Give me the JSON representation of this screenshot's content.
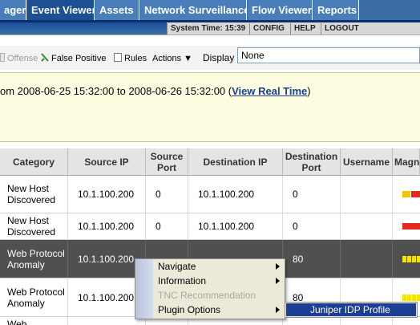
{
  "tabs": [
    {
      "label": "ager",
      "active": false
    },
    {
      "label": "Event Viewer",
      "active": true
    },
    {
      "label": "Assets",
      "active": false
    },
    {
      "label": "Network Surveillance",
      "active": false
    },
    {
      "label": "Flow Viewer",
      "active": false
    },
    {
      "label": "Reports",
      "active": false
    }
  ],
  "sysbar": {
    "time": "System Time: 15:39",
    "config": "CONFIG",
    "help": "HELP",
    "logout": "LOGOUT"
  },
  "toolbar": {
    "offense": "Offense",
    "false_positive": "False Positive",
    "rules": "Rules",
    "actions": "Actions ▼",
    "display_label": "Display",
    "display_value": "None"
  },
  "info": {
    "range_text": "om 2008-06-25 15:32:00 to 2008-06-26 15:32:00  (",
    "link": "View Real Time",
    "close_paren": ")"
  },
  "table": {
    "headers": {
      "category": "Category",
      "source_ip": "Source IP",
      "source_port": "Source Port",
      "destination_ip": "Destination IP",
      "destination_port": "Destination Port",
      "username": "Username",
      "magnitude": "Magn"
    },
    "rows": [
      {
        "category": "New Host Discovered",
        "source_ip": "10.1.100.200",
        "source_port": "0",
        "destination_ip": "10.1.100.200",
        "destination_port": "0",
        "username": "",
        "selected": false
      },
      {
        "category": "New Host Discovered",
        "source_ip": "10.1.100.200",
        "source_port": "0",
        "destination_ip": "10.1.100.200",
        "destination_port": "0",
        "username": "",
        "selected": false
      },
      {
        "category": "Web Protocol Anomaly",
        "source_ip": "10.1.100.200",
        "source_port": "",
        "destination_ip": "",
        "destination_port": "80",
        "username": "",
        "selected": true
      },
      {
        "category": "Web Protocol Anomaly",
        "source_ip": "10.1.100.200",
        "source_port": "",
        "destination_ip": "",
        "destination_port": "80",
        "username": "",
        "selected": false
      },
      {
        "category": "Web",
        "source_ip": "",
        "source_port": "",
        "destination_ip": "",
        "destination_port": "",
        "username": "",
        "selected": false
      }
    ]
  },
  "context_menu": {
    "items": [
      {
        "label": "Navigate",
        "disabled": false,
        "submenu": true
      },
      {
        "label": "Information",
        "disabled": false,
        "submenu": true
      },
      {
        "label": "TNC Recommendation",
        "disabled": true,
        "submenu": false
      },
      {
        "label": "Plugin Options",
        "disabled": false,
        "submenu": true
      }
    ],
    "submenu_item": "Juniper IDP Profile"
  },
  "colors": {
    "tab_bg": "#4a7ebb",
    "tab_active": "#1d4f94",
    "selected_row": "#505050",
    "info_bg": "#fefde1",
    "link": "#1a3e93",
    "highlight": "#1c3f94"
  }
}
